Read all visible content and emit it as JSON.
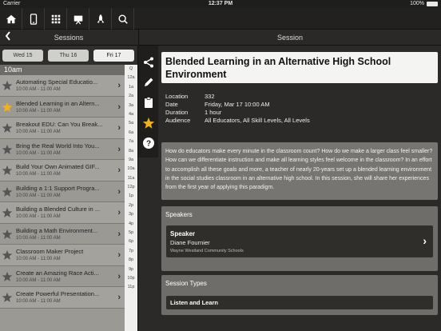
{
  "status_bar": {
    "carrier": "Carrier",
    "time": "12:37 PM",
    "battery": "100%"
  },
  "toolbar": {
    "icons": [
      "home-icon",
      "phone-icon",
      "grid-icon",
      "presentation-icon",
      "rocket-icon",
      "search-icon"
    ]
  },
  "left_panel": {
    "title": "Sessions",
    "back_icon": "chevron-left-icon",
    "days": [
      {
        "label": "Wed 15",
        "active": false
      },
      {
        "label": "Thu 16",
        "active": false
      },
      {
        "label": "Fri 17",
        "active": true
      }
    ],
    "time_header": "10am",
    "sessions": [
      {
        "title": "Automating Special Educatio...",
        "time": "10:00 AM - 11:00 AM",
        "starred": false
      },
      {
        "title": "Blended Learning in an Altern...",
        "time": "10:00 AM - 11:00 AM",
        "starred": true
      },
      {
        "title": "Breakout EDU: Can You Break...",
        "time": "10:00 AM - 11:00 AM",
        "starred": false
      },
      {
        "title": "Bring the Real World Into You...",
        "time": "10:00 AM - 11:00 AM",
        "starred": false
      },
      {
        "title": "Build Your Own Animated GIF...",
        "time": "10:00 AM - 11:00 AM",
        "starred": false
      },
      {
        "title": "Building a 1:1 Support Progra...",
        "time": "10:00 AM - 11:00 AM",
        "starred": false
      },
      {
        "title": "Building a Blended Culture in ...",
        "time": "10:00 AM - 11:00 AM",
        "starred": false
      },
      {
        "title": "Building a Math Environment...",
        "time": "10:00 AM - 11:00 AM",
        "starred": false
      },
      {
        "title": "Classroom Maker Project",
        "time": "10:00 AM - 11:00 AM",
        "starred": false
      },
      {
        "title": "Create an Amazing Race Acti...",
        "time": "10:00 AM - 11:00 AM",
        "starred": false
      },
      {
        "title": "Create Powerful Presentation...",
        "time": "10:00 AM - 11:00 AM",
        "starred": false
      }
    ],
    "index": [
      "Q",
      "12a",
      "1a",
      "2a",
      "3a",
      "4a",
      "5a",
      "6a",
      "7a",
      "8a",
      "9a",
      "10a",
      "11a",
      "12p",
      "1p",
      "2p",
      "3p",
      "4p",
      "5p",
      "6p",
      "7p",
      "8p",
      "9p",
      "10p",
      "11p"
    ]
  },
  "right_panel": {
    "title": "Session",
    "rail_icons": [
      "share-icon",
      "pencil-icon",
      "clipboard-icon",
      "star-icon",
      "help-icon"
    ],
    "session_title": "Blended Learning in an Alternative High School Environment",
    "meta": [
      {
        "key": "Location",
        "value": "332"
      },
      {
        "key": "Date",
        "value": "Friday, Mar 17 10:00 AM"
      },
      {
        "key": "Duration",
        "value": "1 hour"
      },
      {
        "key": "Audience",
        "value": "All Educators, All Skill Levels, All Levels"
      }
    ],
    "description": "How do educators make every minute in the classroom count? How do we make a larger class feel smaller? How can we differentiate instruction and make all learning styles feel welcome in the classroom? In an effort to accomplish all these goals and more, a teacher of nearly 20-years set up a blended learning environment in the social studies classroom in an alternative high school. In this session, she will share her experiences from the first year of applying this paradigm.",
    "speakers_header": "Speakers",
    "speaker": {
      "role": "Speaker",
      "name": "Diane Fournier",
      "org": "Wayne Westland Community Schools"
    },
    "types_header": "Session Types",
    "session_type": "Listen and Learn"
  },
  "colors": {
    "star_active": "#f2b319",
    "star_inactive": "#555555"
  }
}
